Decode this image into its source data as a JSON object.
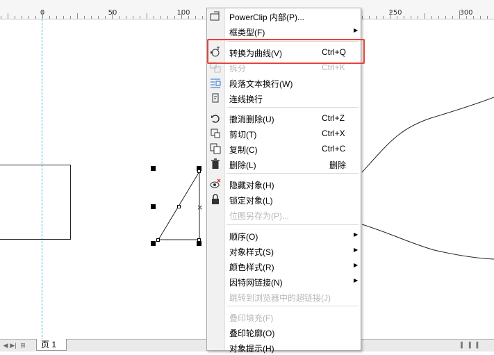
{
  "ruler": {
    "ticks": [
      "0",
      "50",
      "100",
      "250",
      "300"
    ]
  },
  "page_tabs": {
    "page_label": "页 1"
  },
  "menu": {
    "items": [
      {
        "label": "PowerClip 内部(P)...",
        "shortcut": "",
        "submenu": false,
        "disabled": false,
        "icon": "powerclip-icon"
      },
      {
        "label": "框类型(F)",
        "shortcut": "",
        "submenu": true,
        "disabled": false,
        "icon": ""
      },
      {
        "label": "转换为曲线(V)",
        "shortcut": "Ctrl+Q",
        "submenu": false,
        "disabled": false,
        "icon": "convert-to-curves-icon"
      },
      {
        "label": "拆分",
        "shortcut": "Ctrl+K",
        "submenu": false,
        "disabled": true,
        "icon": "break-apart-icon"
      },
      {
        "label": "段落文本换行(W)",
        "shortcut": "",
        "submenu": false,
        "disabled": false,
        "icon": "wrap-paragraph-text-icon"
      },
      {
        "label": "连线换行",
        "shortcut": "",
        "submenu": false,
        "disabled": false,
        "icon": "connector-wrap-icon"
      },
      {
        "label": "撤消删除(U)",
        "shortcut": "Ctrl+Z",
        "submenu": false,
        "disabled": false,
        "icon": "undo-icon"
      },
      {
        "label": "剪切(T)",
        "shortcut": "Ctrl+X",
        "submenu": false,
        "disabled": false,
        "icon": "cut-icon"
      },
      {
        "label": "复制(C)",
        "shortcut": "Ctrl+C",
        "submenu": false,
        "disabled": false,
        "icon": "copy-icon"
      },
      {
        "label": "删除(L)",
        "shortcut": "删除",
        "submenu": false,
        "disabled": false,
        "icon": "trash-icon"
      },
      {
        "label": "隐藏对象(H)",
        "shortcut": "",
        "submenu": false,
        "disabled": false,
        "icon": "hide-object-icon"
      },
      {
        "label": "锁定对象(L)",
        "shortcut": "",
        "submenu": false,
        "disabled": false,
        "icon": "lock-icon"
      },
      {
        "label": "位图另存为(P)...",
        "shortcut": "",
        "submenu": false,
        "disabled": true,
        "icon": ""
      },
      {
        "label": "顺序(O)",
        "shortcut": "",
        "submenu": true,
        "disabled": false,
        "icon": ""
      },
      {
        "label": "对象样式(S)",
        "shortcut": "",
        "submenu": true,
        "disabled": false,
        "icon": ""
      },
      {
        "label": "颜色样式(R)",
        "shortcut": "",
        "submenu": true,
        "disabled": false,
        "icon": ""
      },
      {
        "label": "因特网链接(N)",
        "shortcut": "",
        "submenu": true,
        "disabled": false,
        "icon": ""
      },
      {
        "label": "跳转到浏览器中的超链接(J)",
        "shortcut": "",
        "submenu": false,
        "disabled": true,
        "icon": ""
      },
      {
        "label": "叠印填充(F)",
        "shortcut": "",
        "submenu": false,
        "disabled": true,
        "icon": ""
      },
      {
        "label": "叠印轮廓(O)",
        "shortcut": "",
        "submenu": false,
        "disabled": false,
        "icon": ""
      },
      {
        "label": "对象提示(H)",
        "shortcut": "",
        "submenu": false,
        "disabled": false,
        "icon": ""
      }
    ]
  },
  "colors": {
    "highlight": "#e8413a",
    "guide": "#39b3e6",
    "disabled_text": "#b8b8b8"
  }
}
